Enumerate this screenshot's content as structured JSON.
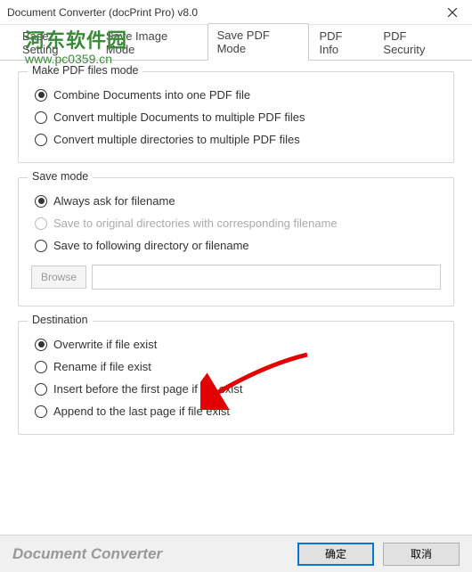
{
  "window": {
    "title": "Document Converter (docPrint Pro) v8.0"
  },
  "watermark": {
    "main": "河东软件园",
    "sub": "www.pc0359.cn"
  },
  "tabs": {
    "items": [
      {
        "label": "Base Setting"
      },
      {
        "label": "Save Image Mode"
      },
      {
        "label": "Save PDF Mode"
      },
      {
        "label": "PDF Info"
      },
      {
        "label": "PDF Security"
      }
    ],
    "active_index": 2
  },
  "groups": {
    "make_mode": {
      "title": "Make PDF files mode",
      "options": [
        "Combine Documents into one PDF file",
        "Convert multiple Documents to multiple PDF files",
        "Convert multiple directories to multiple PDF files"
      ],
      "selected": 0
    },
    "save_mode": {
      "title": "Save mode",
      "options": [
        "Always ask for filename",
        "Save to original directories with corresponding filename",
        "Save to following directory or filename"
      ],
      "selected": 0,
      "disabled": [
        1
      ],
      "browse_label": "Browse",
      "path_value": ""
    },
    "destination": {
      "title": "Destination",
      "options": [
        "Overwrite if file exist",
        "Rename if file exist",
        "Insert before the first page if file exist",
        "Append to the last page if file exist"
      ],
      "selected": 0
    }
  },
  "footer": {
    "brand": "Document Converter",
    "ok": "确定",
    "cancel": "取消"
  },
  "annotation": {
    "arrow_color": "#e20000"
  }
}
